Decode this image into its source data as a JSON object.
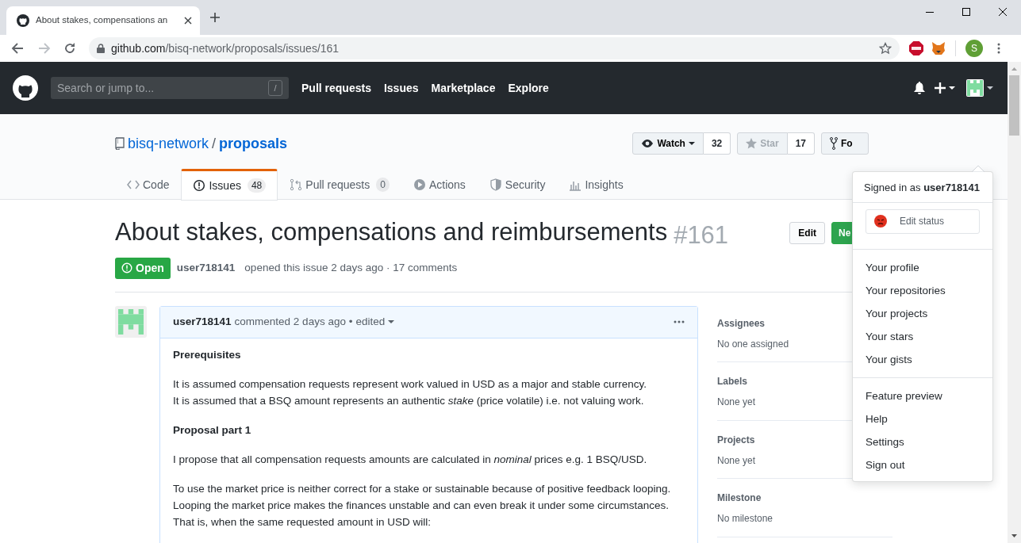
{
  "browser": {
    "tab_title": "About stakes, compensations an",
    "url_host": "github.com",
    "url_path": "/bisq-network/proposals/issues/161",
    "profile_initial": "S"
  },
  "header": {
    "search_placeholder": "Search or jump to...",
    "search_key": "/",
    "nav": [
      "Pull requests",
      "Issues",
      "Marketplace",
      "Explore"
    ]
  },
  "repo": {
    "owner": "bisq-network",
    "separator": "/",
    "name": "proposals",
    "buttons": [
      {
        "label": "Watch",
        "count": "32",
        "kind": "watch"
      },
      {
        "label": "Star",
        "count": "17",
        "kind": "star"
      },
      {
        "label": "Fo",
        "kind": "fork"
      }
    ],
    "tabs": [
      {
        "label": "Code",
        "kind": "code",
        "selected": false
      },
      {
        "label": "Issues",
        "count": "48",
        "kind": "issues",
        "selected": true
      },
      {
        "label": "Pull requests",
        "count": "0",
        "kind": "pulls",
        "selected": false
      },
      {
        "label": "Actions",
        "kind": "actions",
        "selected": false
      },
      {
        "label": "Security",
        "kind": "security",
        "selected": false
      },
      {
        "label": "Insights",
        "kind": "insights",
        "selected": false
      }
    ]
  },
  "issue": {
    "title": "About stakes, compensations and reimbursements",
    "number": "#161",
    "buttons": [
      {
        "label": "Edit",
        "kind": "plain"
      },
      {
        "label": "Ne",
        "kind": "primary"
      }
    ],
    "state": "Open",
    "author": "user718141",
    "meta": "opened this issue 2 days ago · 17 comments"
  },
  "comment": {
    "author": "user718141",
    "meta": "commented 2 days ago •",
    "edited": "edited",
    "blocks": [
      {
        "kind": "heading",
        "lines": [
          "Prerequisites"
        ]
      },
      {
        "kind": "para",
        "lines": [
          "It is assumed compensation requests represent work valued in USD as a major and stable currency.",
          "It is assumed that a BSQ amount represents an authentic *stake* (price volatile) i.e. not valuing work."
        ]
      },
      {
        "kind": "heading",
        "lines": [
          "Proposal part 1"
        ]
      },
      {
        "kind": "para",
        "lines": [
          "I propose that all compensation requests amounts are calculated in *nominal* prices e.g. 1 BSQ/USD."
        ]
      },
      {
        "kind": "para",
        "lines": [
          "To use the market price is neither correct for a stake or sustainable because of positive feedback looping.",
          "Looping the market price makes the finances unstable and can even break it under some circumstances.",
          "That is, when the same requested amount in USD will:"
        ]
      }
    ]
  },
  "sidebar": [
    {
      "heading": "Assignees",
      "value": "No one assigned"
    },
    {
      "heading": "Labels",
      "value": "None yet"
    },
    {
      "heading": "Projects",
      "value": "None yet"
    },
    {
      "heading": "Milestone",
      "value": "No milestone"
    }
  ],
  "dropdown": {
    "signed_in_prefix": "Signed in as",
    "user": "user718141",
    "status_button": "Edit status",
    "groups": [
      [
        "Your profile",
        "Your repositories",
        "Your projects",
        "Your stars",
        "Your gists"
      ],
      [
        "Feature preview",
        "Help",
        "Settings",
        "Sign out"
      ]
    ]
  }
}
